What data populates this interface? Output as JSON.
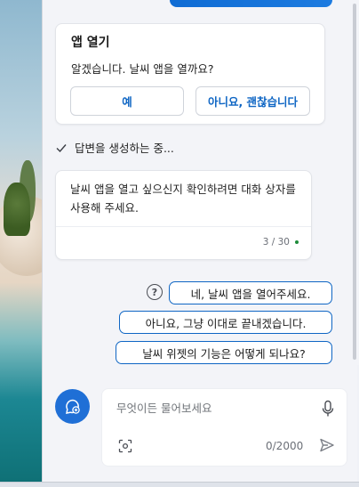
{
  "colors": {
    "accent": "#0f66c4",
    "primary_button": "#1f6fd6",
    "status_dot": "#1e8c3a"
  },
  "open_app_card": {
    "title": "앱 열기",
    "body": "알겠습니다. 날씨 앱을 열까요?",
    "yes_label": "예",
    "no_label": "아니요, 괜찮습니다"
  },
  "status": {
    "icon": "checkmark-icon",
    "text": "답변을 생성하는 중..."
  },
  "answer": {
    "text": "날씨 앱을 열고 싶으신지 확인하려면 대화 상자를 사용해 주세요.",
    "turn_counter": "3 / 30"
  },
  "suggestions": {
    "help_icon": "question-circle-icon",
    "items": [
      "네, 날씨 앱을 열어주세요.",
      "아니요, 그냥 이대로 끝내겠습니다.",
      "날씨 위젯의 기능은 어떻게 되나요?"
    ]
  },
  "composer": {
    "new_topic_icon": "new-chat-icon",
    "placeholder": "무엇이든 물어보세요",
    "mic_icon": "microphone-icon",
    "screenshot_icon": "screenshot-icon",
    "char_count": "0/2000",
    "send_icon": "send-icon"
  }
}
